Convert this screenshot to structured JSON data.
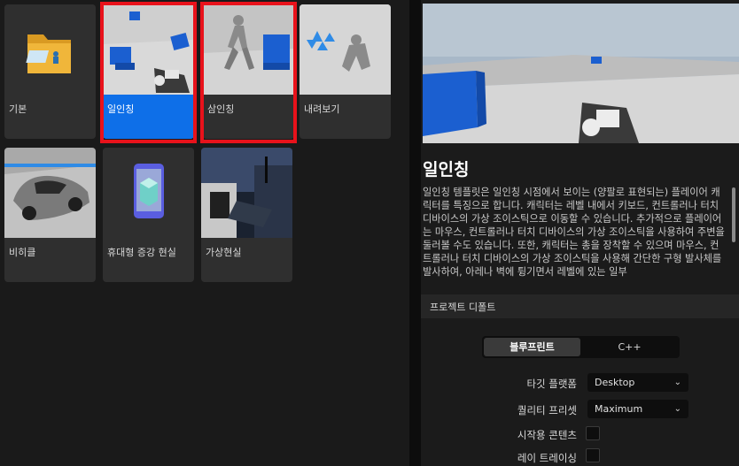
{
  "templates": [
    {
      "label": "기본",
      "icon": "folder-icon"
    },
    {
      "label": "일인칭",
      "icon": "first-person-icon"
    },
    {
      "label": "삼인칭",
      "icon": "third-person-icon"
    },
    {
      "label": "내려보기",
      "icon": "top-down-icon"
    },
    {
      "label": "비히클",
      "icon": "vehicle-icon"
    },
    {
      "label": "휴대형 증강 현실",
      "icon": "handheld-ar-icon"
    },
    {
      "label": "가상현실",
      "icon": "virtual-reality-icon"
    }
  ],
  "selected_index": 1,
  "details": {
    "title": "일인칭",
    "description": "일인칭 템플릿은 일인칭 시점에서 보이는 (양팔로 표현되는) 플레이어 캐릭터를 특징으로 합니다. 캐릭터는 레벨 내에서 키보드, 컨트롤러나 터치 디바이스의 가상 조이스틱으로 이동할 수 있습니다. 추가적으로 플레이어는 마우스, 컨트롤러나 터치 디바이스의 가상 조이스틱을 사용하여 주변을 둘러볼 수도 있습니다. 또한, 캐릭터는 총을 장착할 수 있으며 마우스, 컨트롤러나 터치 디바이스의 가상 조이스틱을 사용해 간단한 구형 발사체를 발사하여, 아레나 벽에 튕기면서 레벨에 있는 일부"
  },
  "project_defaults": {
    "header": "프로젝트 디폴트",
    "blueprint_label": "블루프린트",
    "cpp_label": "C++",
    "target_platform_label": "타깃 플랫폼",
    "target_platform_value": "Desktop",
    "quality_preset_label": "퀄리티 프리셋",
    "quality_preset_value": "Maximum",
    "starter_content_label": "시작용 콘텐츠",
    "raytracing_label": "레이 트레이싱"
  },
  "colors": {
    "selection": "#0e6fe8",
    "highlight_box": "#e8121b"
  }
}
